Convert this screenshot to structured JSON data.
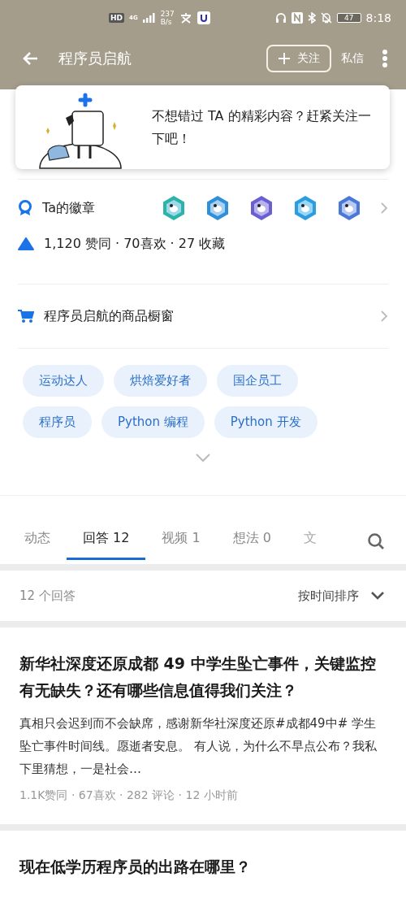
{
  "status_bar": {
    "hd": "HD",
    "network": "4G",
    "speed": "237",
    "speed_unit": "B/s",
    "battery": "47",
    "time": "8:18"
  },
  "app_bar": {
    "title": "程序员启航",
    "follow_button": "关注",
    "message_button": "私信"
  },
  "follow_prompt": {
    "text": "不想错过 TA 的精彩内容？赶紧关注一下吧！"
  },
  "profile": {
    "badges_label": "Ta的徽章",
    "stats": "1,120 赞同 · 70喜欢 · 27 收藏",
    "shop_label": "程序员启航的商品橱窗"
  },
  "tags": [
    {
      "label": "运动达人"
    },
    {
      "label": "烘焙爱好者"
    },
    {
      "label": "国企员工"
    },
    {
      "label": "程序员"
    },
    {
      "label": "Python 编程"
    },
    {
      "label": "Python 开发"
    }
  ],
  "tabs": [
    {
      "label": "动态",
      "selected": false,
      "faded": false
    },
    {
      "label": "回答 12",
      "selected": true,
      "faded": false
    },
    {
      "label": "视频 1",
      "selected": false,
      "faded": false
    },
    {
      "label": "想法 0",
      "selected": false,
      "faded": false
    },
    {
      "label": "文",
      "selected": false,
      "faded": true
    }
  ],
  "answers_header": {
    "count": "12 个回答",
    "sort": "按时间排序"
  },
  "answers": [
    {
      "title": "新华社深度还原成都 49 中学生坠亡事件，关键监控有无缺失？还有哪些信息值得我们关注？",
      "excerpt": "真相只会迟到而不会缺席，感谢新华社深度还原#成都49中# 学生坠亡事件时间线。愿逝者安息。 有人说，为什么不早点公布？我私下里猜想，一是社会…",
      "meta": "1.1K赞同 · 67喜欢 · 282 评论 · 12 小时前"
    },
    {
      "title": "现在低学历程序员的出路在哪里？"
    }
  ]
}
